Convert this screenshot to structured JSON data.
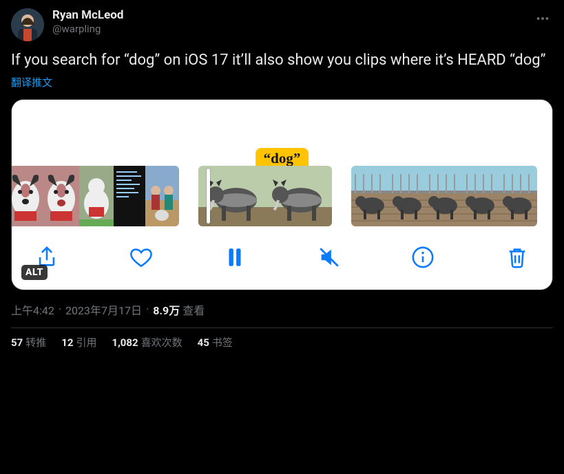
{
  "author": {
    "display_name": "Ryan McLeod",
    "handle": "@warpling"
  },
  "body": "If you search for “dog” on iOS 17 it’ll also show you clips where it’s HEARD “dog”",
  "translate_label": "翻译推文",
  "embed": {
    "tag_text": "“dog”",
    "alt_badge": "ALT",
    "toolbar_icons": {
      "share": "share-icon",
      "heart": "heart-icon",
      "pause": "pause-icon",
      "mute": "volume-muted-icon",
      "info": "info-icon",
      "trash": "trash-icon"
    }
  },
  "meta": {
    "time": "上午4:42",
    "date": "2023年7月17日",
    "views_count": "8.9万",
    "views_label": "查看"
  },
  "stats": {
    "retweets": {
      "count": "57",
      "label": "转推"
    },
    "quotes": {
      "count": "12",
      "label": "引用"
    },
    "likes": {
      "count": "1,082",
      "label": "喜欢次数"
    },
    "bookmarks": {
      "count": "45",
      "label": "书签"
    }
  }
}
